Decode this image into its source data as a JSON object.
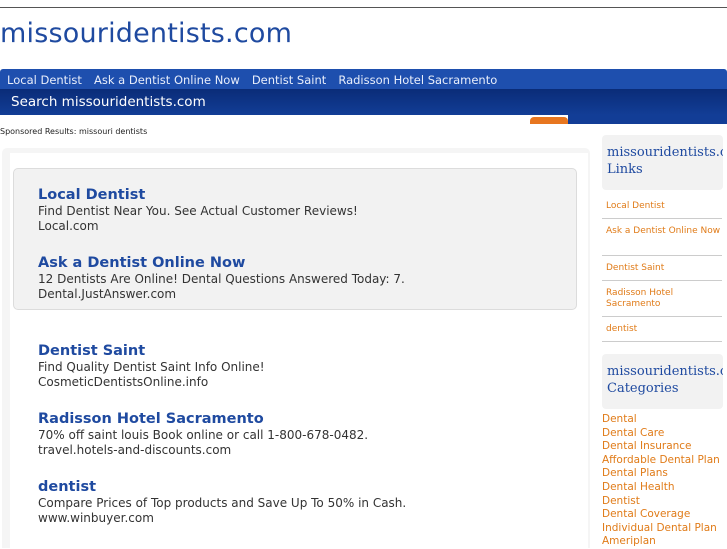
{
  "site": {
    "title": "missouridentists.com"
  },
  "nav": {
    "items": [
      "Local Dentist",
      "Ask a Dentist Online Now",
      "Dentist Saint",
      "Radisson Hotel Sacramento"
    ]
  },
  "search": {
    "title": "Search missouridentists.com"
  },
  "sponsored_label": "Sponsored Results: missouri dentists",
  "ads": [
    {
      "title": "Local Dentist",
      "desc": "Find Dentist Near You. See Actual Customer Reviews!",
      "url": "Local.com"
    },
    {
      "title": "Ask a Dentist Online Now",
      "desc": "12 Dentists Are Online! Dental Questions Answered Today: 7.",
      "url": "Dental.JustAnswer.com"
    },
    {
      "title": "Dentist Saint",
      "desc": "Find Quality Dentist Saint Info Online!",
      "url": "CosmeticDentistsOnline.info"
    },
    {
      "title": "Radisson Hotel Sacramento",
      "desc": "70% off saint louis Book online or call 1-800-678-0482.",
      "url": "travel.hotels-and-discounts.com"
    },
    {
      "title": "dentist",
      "desc": "Compare Prices of Top products and Save Up To 50% in Cash.",
      "url": "www.winbuyer.com"
    }
  ],
  "sidebar": {
    "links_title_1": "missouridentists.com",
    "links_title_2": "Links",
    "links": [
      "Local Dentist",
      "Ask a Dentist Online Now",
      "Dentist Saint",
      "Radisson Hotel Sacramento",
      "dentist"
    ],
    "categories_title_1": "missouridentists.com",
    "categories_title_2": "Categories",
    "categories": [
      "Dental",
      "Dental Care",
      "Dental Insurance",
      "Affordable Dental Plan",
      "Dental Plans",
      "Dental Health",
      "Dentist",
      "Dental Coverage",
      "Individual Dental Plan",
      "Ameriplan"
    ]
  },
  "colors": {
    "brand_blue": "#1f4aa0",
    "nav_blue": "#1e4fae",
    "accent_orange": "#e07b18"
  }
}
